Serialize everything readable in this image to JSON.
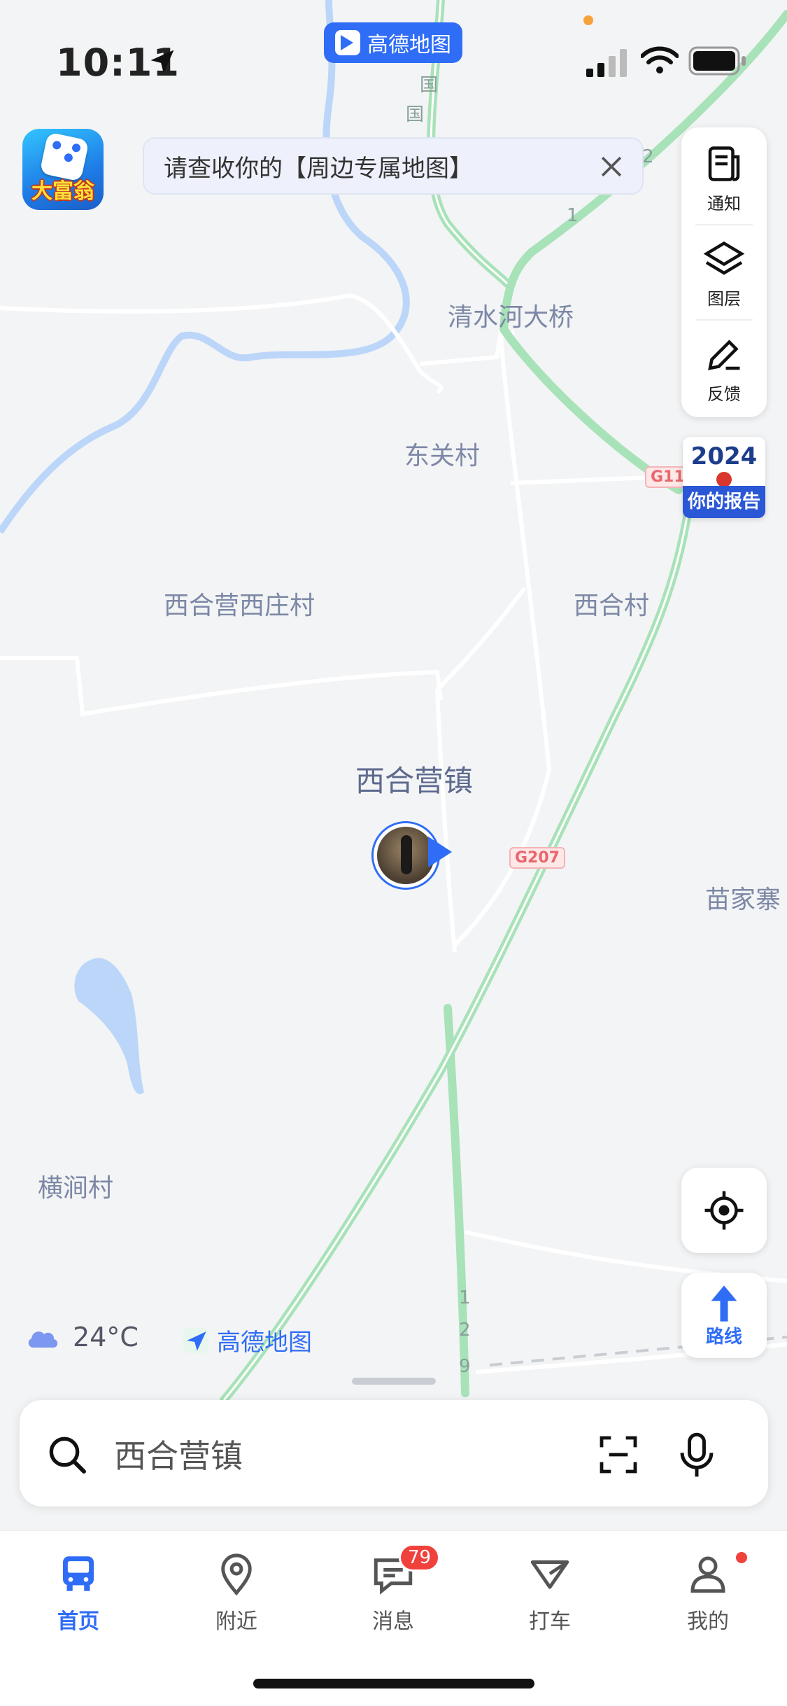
{
  "status_bar": {
    "time": "10:11"
  },
  "top_pill": {
    "label": "高德地图"
  },
  "app_promo": {
    "label": "大富翁"
  },
  "banner": {
    "text": "请查收你的【周边专属地图】"
  },
  "right_panel": {
    "notify": "通知",
    "layers": "图层",
    "feedback": "反馈"
  },
  "report": {
    "year": "2024",
    "label": "你的报告"
  },
  "map": {
    "labels": {
      "bridge": "清水河大桥",
      "dongguan": "东关村",
      "xihe_xizhuang": "西合营西庄村",
      "xihe_cun": "西合村",
      "town": "西合营镇",
      "miaojia": "苗家寨",
      "hengjian": "横涧村"
    },
    "shields": {
      "g11": "G11",
      "g207": "G207"
    },
    "road_chars": [
      "1",
      "1",
      "2",
      "9",
      "国",
      "国",
      "2"
    ]
  },
  "weather": {
    "temp": "24°C"
  },
  "brand": {
    "text": "高德地图"
  },
  "route_button": {
    "label": "路线"
  },
  "search": {
    "placeholder": "西合营镇"
  },
  "tabs": [
    {
      "label": "首页"
    },
    {
      "label": "附近"
    },
    {
      "label": "消息",
      "badge": "79"
    },
    {
      "label": "打车"
    },
    {
      "label": "我的"
    }
  ],
  "colors": {
    "accent": "#2f6df6",
    "road_green": "#a8e2b8",
    "water": "#bcd6fa"
  }
}
